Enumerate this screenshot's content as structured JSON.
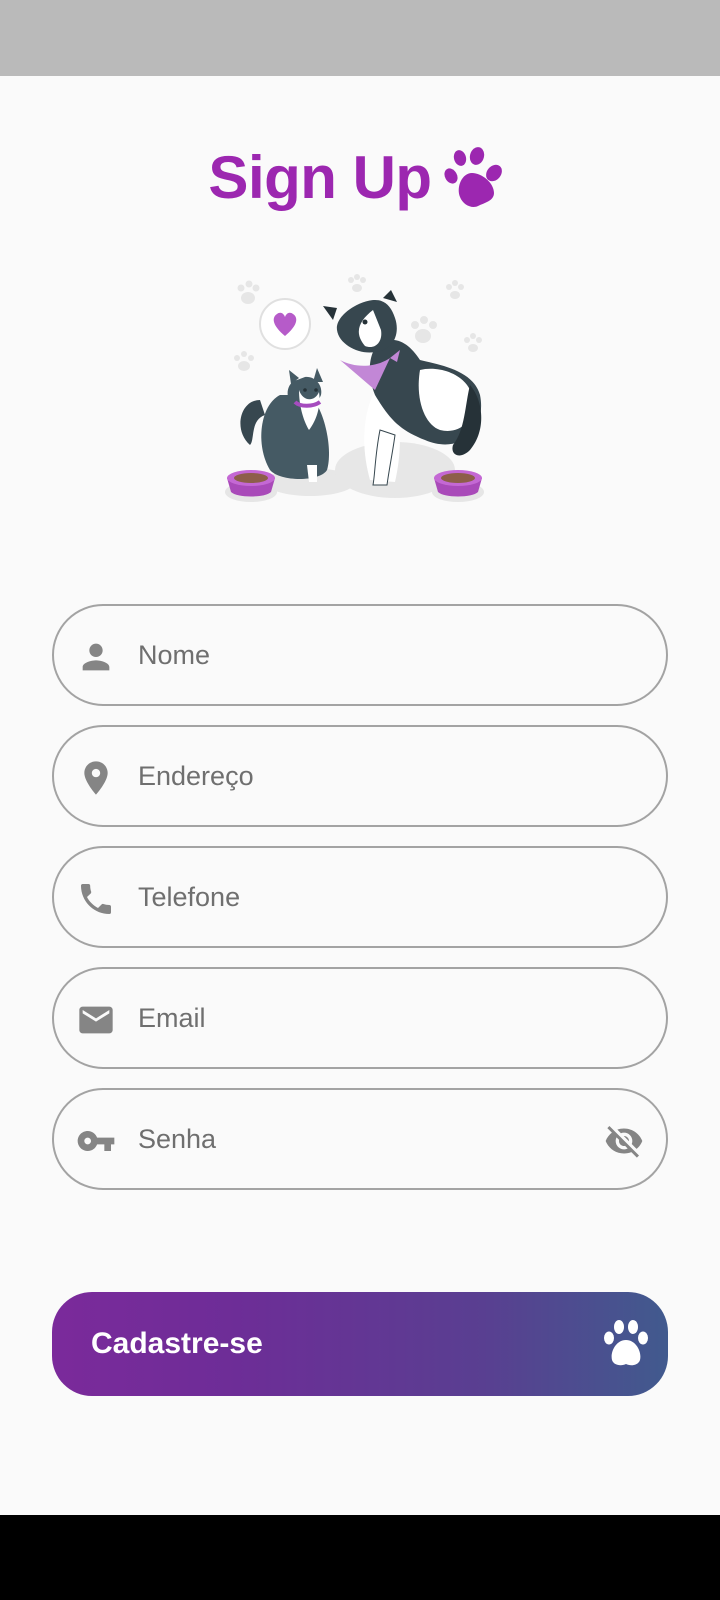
{
  "header": {
    "title": "Sign Up",
    "title_icon": "paw-icon"
  },
  "illustration": {
    "name": "dog-and-cat-illustration"
  },
  "form": {
    "fields": [
      {
        "name": "name-field",
        "icon": "person-icon",
        "placeholder": "Nome"
      },
      {
        "name": "address-field",
        "icon": "location-pin-icon",
        "placeholder": "Endereço"
      },
      {
        "name": "phone-field",
        "icon": "phone-icon",
        "placeholder": "Telefone"
      },
      {
        "name": "email-field",
        "icon": "mail-icon",
        "placeholder": "Email"
      },
      {
        "name": "password-field",
        "icon": "key-icon",
        "placeholder": "Senha",
        "trailing_icon": "visibility-off-icon"
      }
    ]
  },
  "submit": {
    "label": "Cadastre-se",
    "icon": "paw-icon"
  },
  "colors": {
    "accent": "#9c27b0",
    "button_gradient_start": "#7b2a9b",
    "button_gradient_end": "#415a8e",
    "field_border": "#a3a3a3",
    "placeholder_text": "#6f6f6f",
    "background": "#fafafa"
  }
}
